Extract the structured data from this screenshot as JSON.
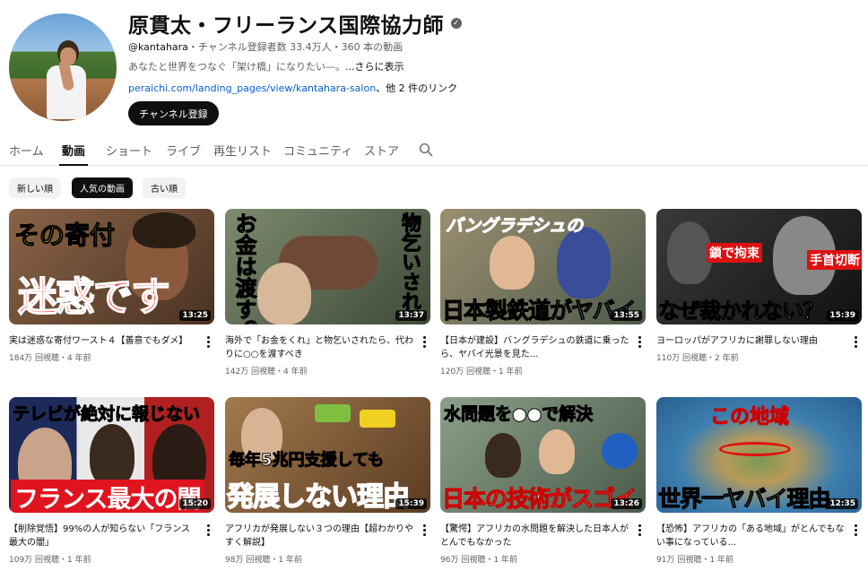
{
  "channel": {
    "name": "原貫太・フリーランス国際協力師",
    "handle": "@kantahara",
    "stats": "・チャンネル登録者数 33.4万人・360 本の動画",
    "description": "あなたと世界をつなぐ「架け橋」になりたい—。",
    "more": "...さらに表示",
    "link": "peraichi.com/landing_pages/view/kantahara-salon",
    "link_rest": "、他 2 件のリンク",
    "subscribe": "チャンネル登録",
    "verified_icon": "check-circle-icon"
  },
  "tabs": [
    "ホーム",
    "動画",
    "ショート",
    "ライブ",
    "再生リスト",
    "コミュニティ",
    "ストア"
  ],
  "active_tab": "動画",
  "chips": [
    "新しい順",
    "人気の動画",
    "古い順"
  ],
  "active_chip": "人気の動画",
  "videos": [
    {
      "title": "実は迷惑な寄付ワースト４【善意でもダメ】",
      "meta": "184万 回視聴・4 年前",
      "duration": "13:25",
      "thumb": {
        "line1": "その寄付",
        "line2": "迷惑です",
        "bg": "#6b4b35"
      }
    },
    {
      "title": "海外で「お金をくれ」と物乞いされたら、代わりに○○を渡すべき",
      "meta": "142万 回視聴・4 年前",
      "duration": "13:37",
      "thumb": {
        "line1": "お金は渡す？",
        "line2": "物乞いされ",
        "bg": "#5c6b55"
      }
    },
    {
      "title": "【日本が建設】バングラデシュの鉄道に乗ったら、ヤバイ光景を見た...",
      "meta": "120万 回視聴・1 年前",
      "duration": "13:55",
      "thumb": {
        "line1": "バングラデシュの",
        "line2": "日本製鉄道がヤバイ",
        "bg": "#7a7060"
      }
    },
    {
      "title": "ヨーロッパがアフリカに謝罪しない理由",
      "meta": "110万 回視聴・2 年前",
      "duration": "15:39",
      "thumb": {
        "line1": "鎖で拘束",
        "line2": "なぜ裁かれない？",
        "line3": "手首切断",
        "bg": "#2a2a2a"
      }
    },
    {
      "title": "【削除覚悟】99%の人が知らない「フランス最大の闇」",
      "meta": "109万 回視聴・1 年前",
      "duration": "15:20",
      "thumb": {
        "line1": "テレビが絶対に報じない",
        "line2": "フランス最大の闇",
        "bg": "#3a1a1a"
      }
    },
    {
      "title": "アフリカが発展しない３つの理由【超わかりやすく解説】",
      "meta": "98万 回視聴・1 年前",
      "duration": "15:39",
      "thumb": {
        "line1": "毎年5兆円支援しても",
        "line2": "発展しない理由",
        "bg": "#7a5a3a"
      }
    },
    {
      "title": "【驚愕】アフリカの水問題を解決した日本人がとんでもなかった",
      "meta": "96万 回視聴・1 年前",
      "duration": "13:26",
      "thumb": {
        "line1": "水問題を●●で解決",
        "line2": "日本の技術がスゴイ",
        "bg": "#6a7a6a"
      }
    },
    {
      "title": "【恐怖】アフリカの「ある地域」がとんでもない事になっている...",
      "meta": "91万 回視聴・1 年前",
      "duration": "12:35",
      "thumb": {
        "line1": "この地域",
        "line2": "世界一ヤバイ理由",
        "bg": "#3d7fb0"
      }
    }
  ],
  "icons": {
    "search": "search-icon",
    "more": "more-vert-icon"
  }
}
